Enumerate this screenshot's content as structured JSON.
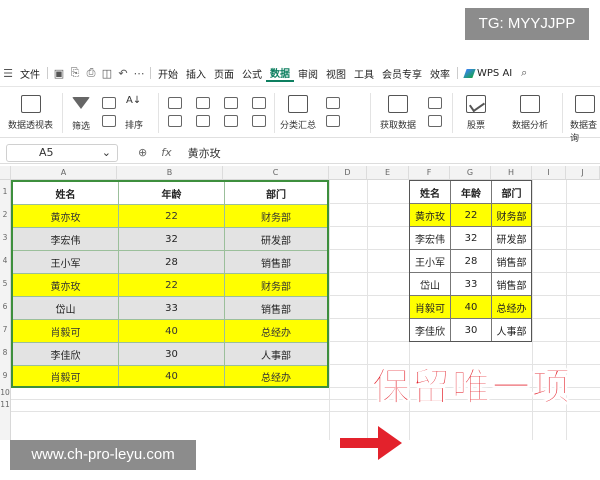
{
  "watermark_top": "TG: MYYJJPP",
  "watermark_bottom": "www.ch-pro-leyu.com",
  "menu": {
    "file": "文件",
    "tabs": [
      "开始",
      "插入",
      "页面",
      "公式",
      "数据",
      "审阅",
      "视图",
      "工具",
      "会员专享",
      "效率"
    ],
    "active_tab": "数据",
    "wps_ai": "WPS AI"
  },
  "ribbon": {
    "pivot": "数据透视表",
    "filter": "筛选",
    "sort": "排序",
    "subtotal": "分类汇总",
    "get_data": "获取数据",
    "stocks": "股票",
    "analysis": "数据分析",
    "query": "数据查询"
  },
  "formula_bar": {
    "cell_ref": "A5",
    "fx": "fx",
    "value": "黄亦玫"
  },
  "columns": [
    "A",
    "B",
    "C",
    "D",
    "E",
    "F",
    "G",
    "H",
    "I",
    "J"
  ],
  "rows": [
    "1",
    "2",
    "3",
    "4",
    "5",
    "6",
    "7",
    "8",
    "9",
    "10",
    "11"
  ],
  "left_table": {
    "headers": [
      "姓名",
      "年龄",
      "部门"
    ],
    "rows": [
      {
        "name": "黄亦玫",
        "age": "22",
        "dept": "财务部",
        "style": "yellow"
      },
      {
        "name": "李宏伟",
        "age": "32",
        "dept": "研发部",
        "style": "gray"
      },
      {
        "name": "王小军",
        "age": "28",
        "dept": "销售部",
        "style": "gray"
      },
      {
        "name": "黄亦玫",
        "age": "22",
        "dept": "财务部",
        "style": "yellow"
      },
      {
        "name": "岱山",
        "age": "33",
        "dept": "销售部",
        "style": "gray"
      },
      {
        "name": "肖毅可",
        "age": "40",
        "dept": "总经办",
        "style": "yellow"
      },
      {
        "name": "李佳欣",
        "age": "30",
        "dept": "人事部",
        "style": "gray"
      },
      {
        "name": "肖毅可",
        "age": "40",
        "dept": "总经办",
        "style": "yellow"
      }
    ]
  },
  "right_table": {
    "headers": [
      "姓名",
      "年龄",
      "部门"
    ],
    "rows": [
      {
        "name": "黄亦玫",
        "age": "22",
        "dept": "财务部",
        "style": "yellow"
      },
      {
        "name": "李宏伟",
        "age": "32",
        "dept": "研发部",
        "style": "white"
      },
      {
        "name": "王小军",
        "age": "28",
        "dept": "销售部",
        "style": "white"
      },
      {
        "name": "岱山",
        "age": "33",
        "dept": "销售部",
        "style": "white"
      },
      {
        "name": "肖毅可",
        "age": "40",
        "dept": "总经办",
        "style": "yellow"
      },
      {
        "name": "李佳欣",
        "age": "30",
        "dept": "人事部",
        "style": "white"
      }
    ]
  },
  "caption": "保留唯一项",
  "colors": {
    "accent": "#0d7f60",
    "highlight": "#ffff00",
    "arrow": "#e3222c"
  }
}
